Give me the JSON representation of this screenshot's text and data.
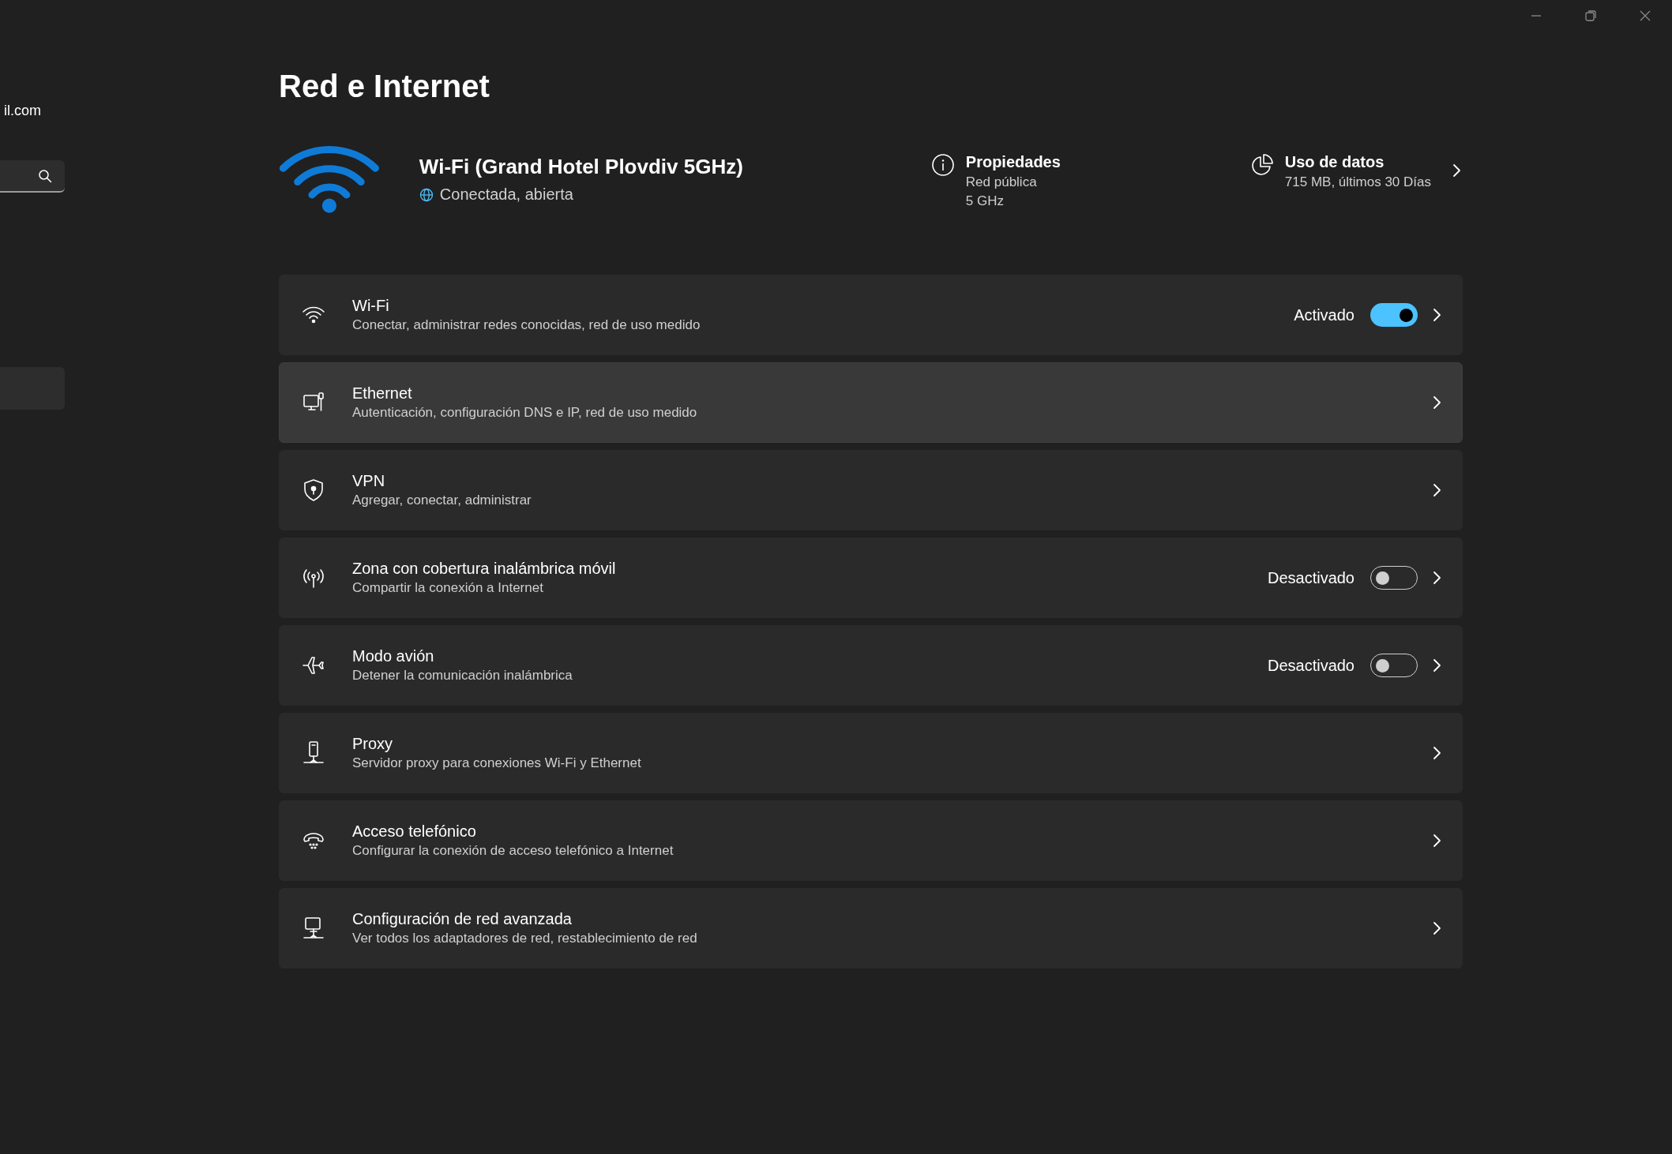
{
  "sidebar": {
    "account_email": "il.com",
    "items": [
      {
        "selected": true
      }
    ]
  },
  "page_title": "Red e Internet",
  "connection": {
    "name": "Wi-Fi (Grand Hotel Plovdiv 5GHz)",
    "status": "Conectada, abierta"
  },
  "properties": {
    "title": "Propiedades",
    "lines": [
      "Red pública",
      "5 GHz"
    ]
  },
  "data_usage": {
    "title": "Uso de datos",
    "detail": "715 MB, últimos 30 Días"
  },
  "rows": [
    {
      "kind": "toggle",
      "title": "Wi-Fi",
      "subtitle": "Conectar, administrar redes conocidas, red de uso medido",
      "state_label": "Activado",
      "on": true,
      "hovered": false
    },
    {
      "kind": "link",
      "title": "Ethernet",
      "subtitle": "Autenticación, configuración DNS e IP, red de uso medido",
      "hovered": true
    },
    {
      "kind": "link",
      "title": "VPN",
      "subtitle": "Agregar, conectar, administrar",
      "hovered": false
    },
    {
      "kind": "toggle",
      "title": "Zona con cobertura inalámbrica móvil",
      "subtitle": "Compartir la conexión a Internet",
      "state_label": "Desactivado",
      "on": false,
      "hovered": false
    },
    {
      "kind": "toggle",
      "title": "Modo avión",
      "subtitle": "Detener la comunicación inalámbrica",
      "state_label": "Desactivado",
      "on": false,
      "hovered": false
    },
    {
      "kind": "link",
      "title": "Proxy",
      "subtitle": "Servidor proxy para conexiones Wi-Fi y Ethernet",
      "hovered": false
    },
    {
      "kind": "link",
      "title": "Acceso telefónico",
      "subtitle": "Configurar la conexión de acceso telefónico a Internet",
      "hovered": false
    },
    {
      "kind": "link",
      "title": "Configuración de red avanzada",
      "subtitle": "Ver todos los adaptadores de red, restablecimiento de red",
      "hovered": false
    }
  ]
}
